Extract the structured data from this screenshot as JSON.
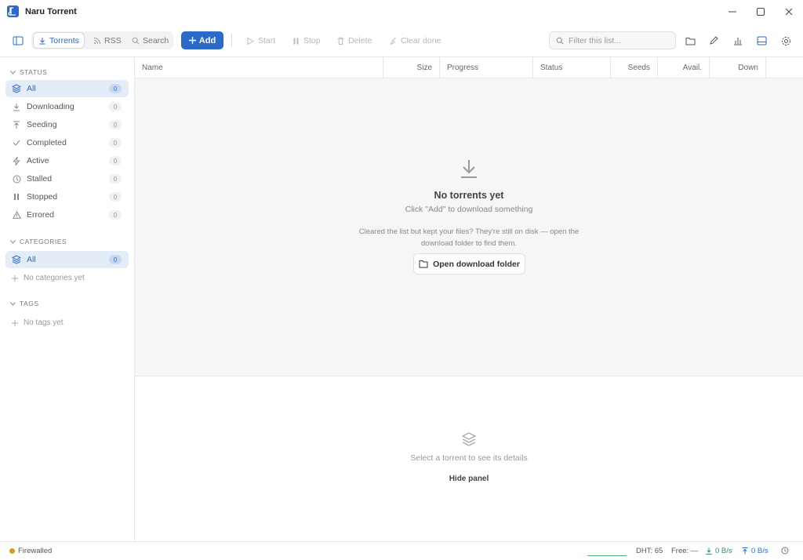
{
  "app": {
    "title": "Naru Torrent",
    "accent": "#2c6ac9"
  },
  "toolbar": {
    "tabs": [
      {
        "label": "Torrents",
        "icon": "download-icon",
        "active": true
      },
      {
        "label": "RSS",
        "icon": "rss-icon",
        "active": false
      },
      {
        "label": "Search",
        "icon": "search-icon",
        "active": false
      }
    ],
    "add_label": "Add",
    "actions": [
      {
        "label": "Start",
        "icon": "play-icon"
      },
      {
        "label": "Stop",
        "icon": "pause-icon"
      },
      {
        "label": "Delete",
        "icon": "trash-icon"
      },
      {
        "label": "Clear done",
        "icon": "broom-icon"
      }
    ],
    "filter_placeholder": "Filter this list...",
    "right_icons": [
      "folder-icon",
      "pencil-icon",
      "bar-chart-icon",
      "panel-bottom-icon",
      "gear-icon"
    ]
  },
  "sidebar": {
    "status_header": "STATUS",
    "status_items": [
      {
        "label": "All",
        "count": "0",
        "icon": "layers-icon",
        "active": true
      },
      {
        "label": "Downloading",
        "count": "0",
        "icon": "download-icon"
      },
      {
        "label": "Seeding",
        "count": "0",
        "icon": "upload-icon"
      },
      {
        "label": "Completed",
        "count": "0",
        "icon": "check-icon"
      },
      {
        "label": "Active",
        "count": "0",
        "icon": "bolt-icon"
      },
      {
        "label": "Stalled",
        "count": "0",
        "icon": "clock-icon"
      },
      {
        "label": "Stopped",
        "count": "0",
        "icon": "pause-icon"
      },
      {
        "label": "Errored",
        "count": "0",
        "icon": "warning-icon"
      }
    ],
    "categories_header": "CATEGORIES",
    "categories_all": {
      "label": "All",
      "count": "0"
    },
    "categories_empty": "No categories yet",
    "tags_header": "TAGS",
    "tags_empty": "No tags yet"
  },
  "table": {
    "columns": [
      "Name",
      "Size",
      "Progress",
      "Status",
      "Seeds",
      "Avail.",
      "Down"
    ]
  },
  "empty_state": {
    "title": "No torrents yet",
    "subtitle": "Click \"Add\" to download something",
    "note": "Cleared the list but kept your files? They're still on disk — open the download folder to find them.",
    "open_folder_label": "Open download folder"
  },
  "detail_panel": {
    "message": "Select a torrent to see its details",
    "hide_label": "Hide panel"
  },
  "statusbar": {
    "connection": "Firewalled",
    "connection_color": "#d4a017",
    "dht": "DHT: 65",
    "free": "Free: —",
    "down_speed": "0 B/s",
    "up_speed": "0 B/s"
  }
}
